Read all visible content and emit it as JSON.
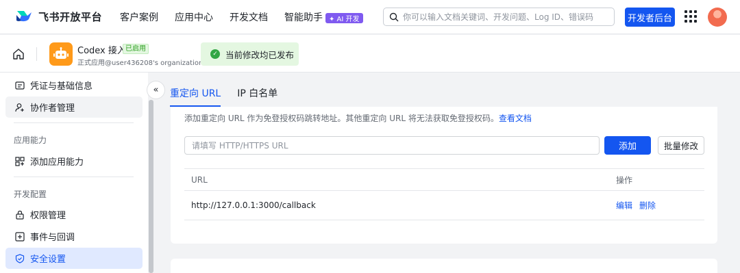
{
  "brand": {
    "name": "飞书开放平台",
    "logo_icon": "feishu-logo-icon"
  },
  "nav": {
    "links": [
      "客户案例",
      "应用中心",
      "开发文档"
    ],
    "assistant": "智能助手",
    "ai_badge": "✦ AI 开发"
  },
  "search": {
    "placeholder": "你可以输入文档关键词、开发问题、Log ID、错误码",
    "icon": "search-icon"
  },
  "header_actions": {
    "dev_console": "开发者后台",
    "apps_icon": "apps-grid-icon"
  },
  "app": {
    "name": "Codex 接入",
    "status": "已启用",
    "subtitle": "正式应用@user436208's organization",
    "icon": "robot-icon"
  },
  "publish_tip": "当前修改均已发布",
  "sidebar": {
    "items_top": [
      {
        "label": "凭证与基础信息",
        "icon": "credentials-icon"
      },
      {
        "label": "协作者管理",
        "icon": "add-user-icon"
      }
    ],
    "group_capability": "应用能力",
    "capability_items": [
      {
        "label": "添加应用能力",
        "icon": "add-capability-icon"
      }
    ],
    "group_dev": "开发配置",
    "dev_items": [
      {
        "label": "权限管理",
        "icon": "lock-icon"
      },
      {
        "label": "事件与回调",
        "icon": "event-icon"
      },
      {
        "label": "安全设置",
        "icon": "shield-icon"
      }
    ],
    "collapse_icon": "double-chevron-left-icon"
  },
  "tabs": [
    "重定向 URL",
    "IP 白名单"
  ],
  "redirect": {
    "description": "添加重定向 URL 作为免登授权码跳转地址。其他重定向 URL 将无法获取免登授权码。",
    "doc_link": "查看文档",
    "input_placeholder": "请填写 HTTP/HTTPS URL",
    "add_button": "添加",
    "bulk_button": "批量修改",
    "table": {
      "headers": [
        "URL",
        "操作"
      ],
      "rows": [
        {
          "url": "http://127.0.0.1:3000/callback",
          "edit": "编辑",
          "delete": "删除"
        }
      ]
    }
  },
  "colors": {
    "primary": "#1456f0",
    "success": "#32a645",
    "app_icon": "#ff9a1a",
    "ai_badge": "#7f5af0"
  }
}
